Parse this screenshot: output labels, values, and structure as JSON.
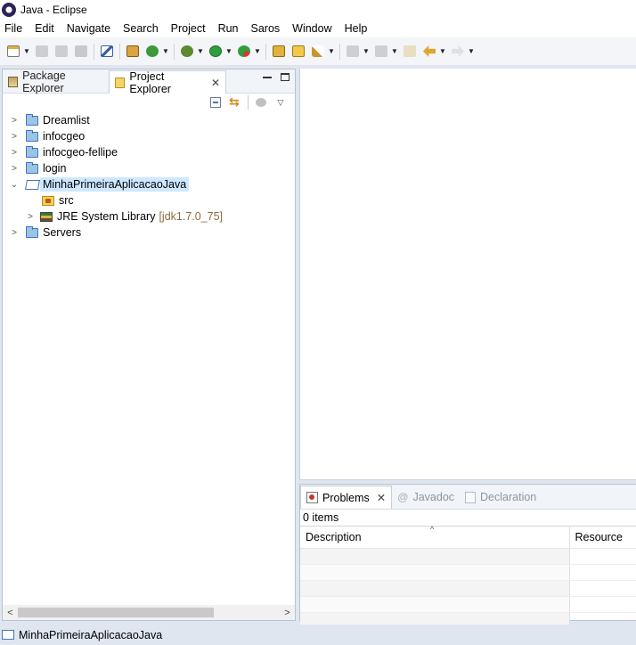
{
  "window": {
    "title": "Java - Eclipse"
  },
  "menubar": [
    "File",
    "Edit",
    "Navigate",
    "Search",
    "Project",
    "Run",
    "Saros",
    "Window",
    "Help"
  ],
  "toolbar_icons": [
    "new-wizard-icon",
    "save-icon",
    "save-all-icon",
    "print-icon",
    "skip-breakpoints-icon",
    "new-java-package-icon",
    "new-java-class-icon",
    "debug-icon",
    "run-icon",
    "run-external-tools-icon",
    "open-type-icon",
    "open-project-icon",
    "search-icon",
    "next-annotation-icon",
    "previous-annotation-icon",
    "last-edit-location-icon",
    "back-icon",
    "forward-icon"
  ],
  "explorer": {
    "tabs": [
      {
        "label": "Package Explorer",
        "icon": "package-explorer-icon",
        "active": false
      },
      {
        "label": "Project Explorer",
        "icon": "project-explorer-icon",
        "active": true
      }
    ],
    "tree": [
      {
        "label": "Dreamlist",
        "expanded": false
      },
      {
        "label": "infocgeo",
        "expanded": false
      },
      {
        "label": "infocgeo-fellipe",
        "expanded": false
      },
      {
        "label": "login",
        "expanded": false
      },
      {
        "label": "MinhaPrimeiraAplicacaoJava",
        "expanded": true,
        "selected": true,
        "children": [
          {
            "label": "src"
          },
          {
            "label": "JRE System Library",
            "decoration": "[jdk1.7.0_75]"
          }
        ]
      },
      {
        "label": "Servers",
        "expanded": false
      }
    ]
  },
  "problems": {
    "tabs": [
      {
        "label": "Problems",
        "active": true
      },
      {
        "label": "Javadoc",
        "active": false
      },
      {
        "label": "Declaration",
        "active": false
      }
    ],
    "count": "0 items",
    "columns": [
      "Description",
      "Resource"
    ]
  },
  "status": {
    "text": "MinhaPrimeiraAplicacaoJava"
  }
}
